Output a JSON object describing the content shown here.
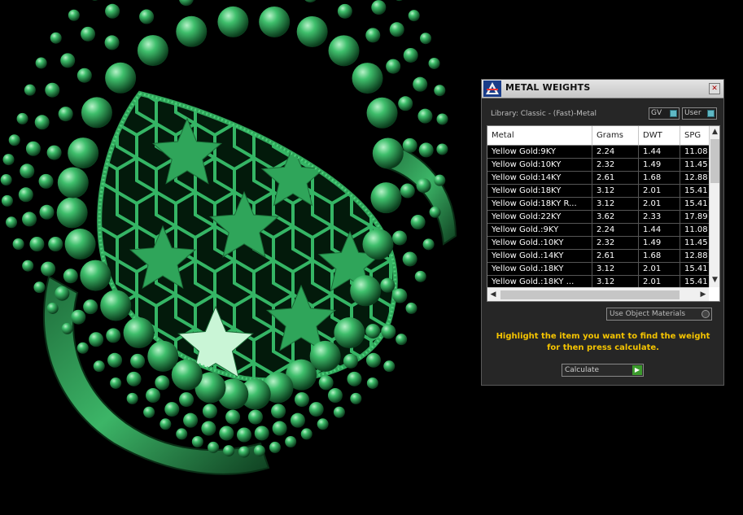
{
  "panel": {
    "title": "METAL WEIGHTS",
    "close_label": "✕",
    "library_label": "Library: Classic - (Fast)-Metal",
    "toggles": {
      "gv": "GV",
      "user": "User"
    },
    "table": {
      "columns": [
        "Metal",
        "Grams",
        "DWT",
        "SPG"
      ],
      "rows": [
        [
          "Yellow Gold:9KY",
          "2.24",
          "1.44",
          "11.08"
        ],
        [
          "Yellow Gold:10KY",
          "2.32",
          "1.49",
          "11.45"
        ],
        [
          "Yellow Gold:14KY",
          "2.61",
          "1.68",
          "12.88"
        ],
        [
          "Yellow Gold:18KY",
          "3.12",
          "2.01",
          "15.41"
        ],
        [
          "Yellow Gold:18KY R...",
          "3.12",
          "2.01",
          "15.41"
        ],
        [
          "Yellow Gold:22KY",
          "3.62",
          "2.33",
          "17.89"
        ],
        [
          "Yellow Gold.:9KY",
          "2.24",
          "1.44",
          "11.08"
        ],
        [
          "Yellow Gold.:10KY",
          "2.32",
          "1.49",
          "11.45"
        ],
        [
          "Yellow Gold.:14KY",
          "2.61",
          "1.68",
          "12.88"
        ],
        [
          "Yellow Gold.:18KY",
          "3.12",
          "2.01",
          "15.41"
        ],
        [
          "Yellow Gold.:18KY ...",
          "3.12",
          "2.01",
          "15.41"
        ]
      ]
    },
    "use_object_materials": "Use Object Materials",
    "hint": "Highlight the item you want to find the weight for then press calculate.",
    "calculate_label": "Calculate"
  },
  "colors": {
    "background": "#000000",
    "ring": "#2fa55a",
    "hint": "#f5c400",
    "toggle_knob": "#5fb8c4",
    "go": "#3b9a2c"
  }
}
